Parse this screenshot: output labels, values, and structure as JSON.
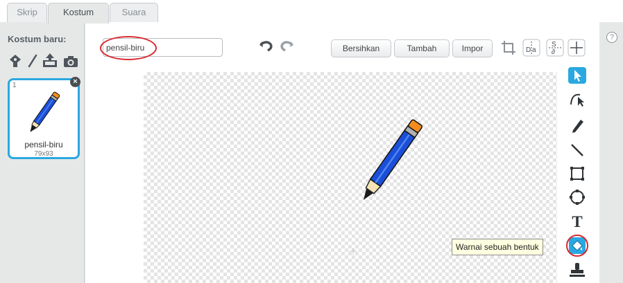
{
  "tabs": [
    {
      "label": "Skrip",
      "active": false
    },
    {
      "label": "Kostum",
      "active": true
    },
    {
      "label": "Suara",
      "active": false
    }
  ],
  "sidebar": {
    "new_costume_label": "Kostum baru:",
    "icons": [
      "paint-new-costume-icon",
      "paintbrush-icon",
      "upload-costume-icon",
      "camera-icon"
    ]
  },
  "costume": {
    "number": "1",
    "name": "pensil-biru",
    "size": "79x93"
  },
  "editor": {
    "name_value": "pensil-biru",
    "buttons": {
      "clear": "Bersihkan",
      "add": "Tambah",
      "import": "Impor"
    },
    "tooltip": "Warnai sebuah bentuk",
    "tools": [
      "select-icon",
      "reshape-icon",
      "pencil-icon",
      "line-icon",
      "rectangle-icon",
      "ellipse-icon",
      "text-icon",
      "fill-bucket-icon",
      "stamp-icon"
    ]
  },
  "colors": {
    "accent": "#2aa8e0",
    "highlight": "#d9272e",
    "pencil_blue": "#1c4fd8",
    "pencil_eraser": "#f28c1f"
  }
}
